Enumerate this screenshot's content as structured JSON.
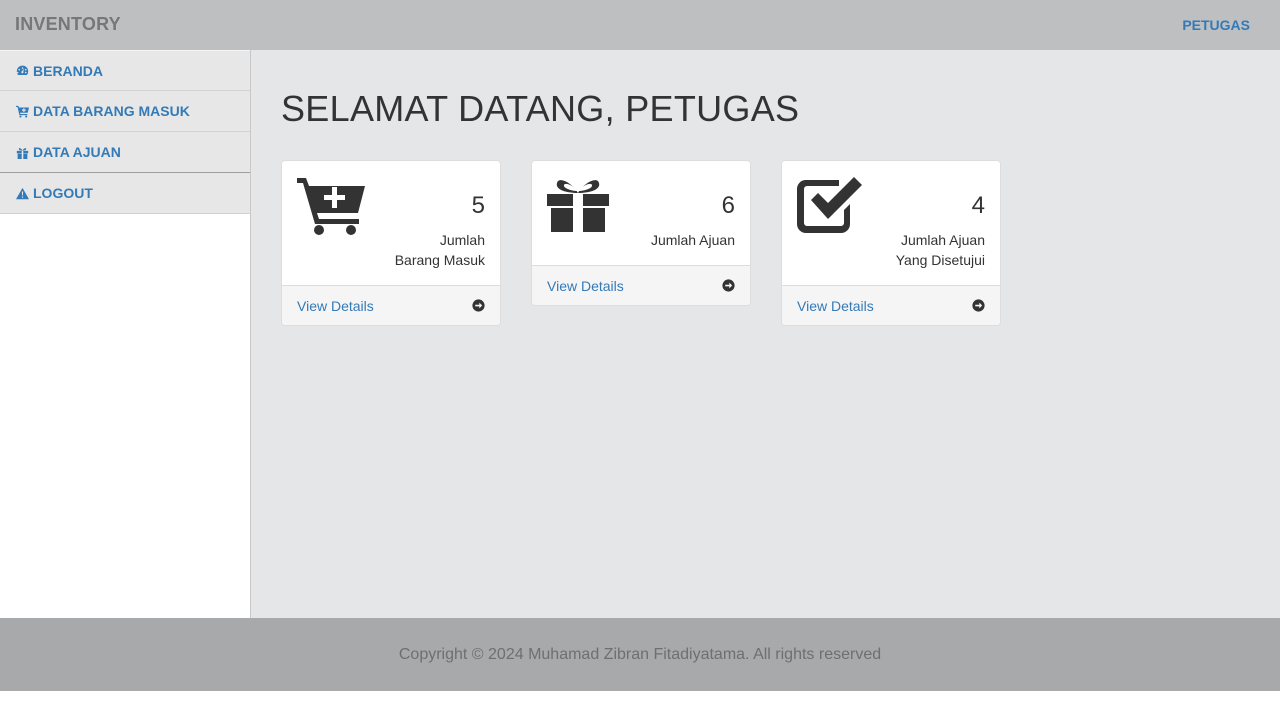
{
  "navbar": {
    "brand": "INVENTORY",
    "user": "PETUGAS"
  },
  "sidebar": {
    "items": [
      {
        "label": "BERANDA",
        "icon": "dashboard-icon"
      },
      {
        "label": "DATA BARANG MASUK",
        "icon": "cart-plus-icon"
      },
      {
        "label": "DATA AJUAN",
        "icon": "gift-icon"
      },
      {
        "label": "LOGOUT",
        "icon": "warning-icon"
      }
    ]
  },
  "main": {
    "title": "SELAMAT DATANG, PETUGAS",
    "cards": [
      {
        "count": "5",
        "label": "Jumlah Barang Masuk",
        "footer": "View Details",
        "icon": "cart-plus-icon"
      },
      {
        "count": "6",
        "label": "Jumlah Ajuan",
        "footer": "View Details",
        "icon": "gift-icon"
      },
      {
        "count": "4",
        "label": "Jumlah Ajuan Yang Disetujui",
        "footer": "View Details",
        "icon": "check-square-icon"
      }
    ]
  },
  "footer": {
    "copyright": "Copyright © 2024 Muhamad Zibran Fitadiyatama. All rights reserved"
  },
  "colors": {
    "link": "#337ab7",
    "navbar_bg": "#bebfc1",
    "main_bg": "#e5e6e8",
    "footer_bg": "#a8a9ab"
  }
}
